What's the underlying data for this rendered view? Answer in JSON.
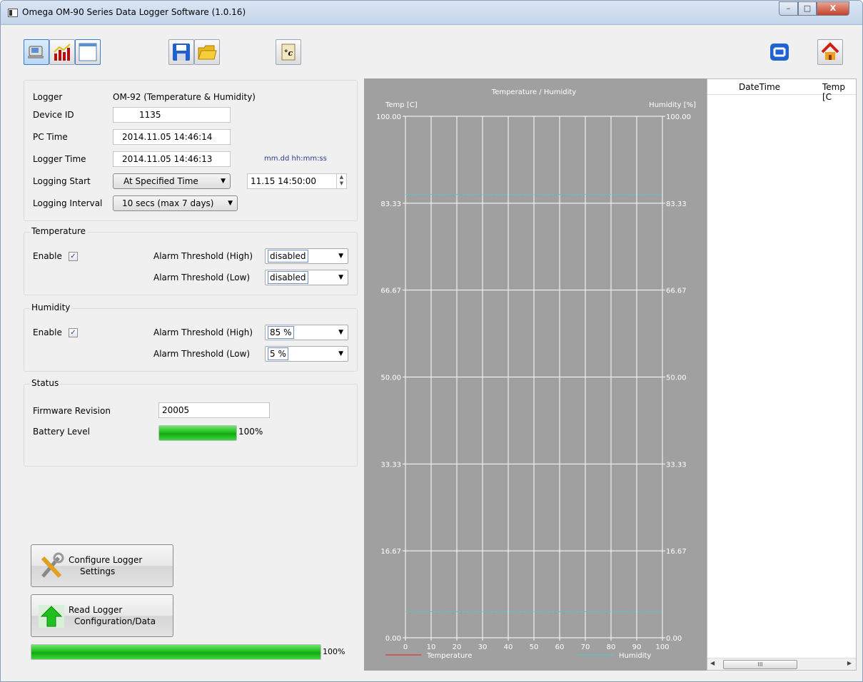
{
  "window": {
    "title": "Omega OM-90 Series Data Logger Software (1.0.16)",
    "min": "–",
    "max": "□",
    "close": "X"
  },
  "logger": {
    "logger_label": "Logger",
    "logger_value": "OM-92 (Temperature & Humidity)",
    "device_id_label": "Device ID",
    "device_id": "1135",
    "pc_time_label": "PC Time",
    "pc_time": "2014.11.05 14:46:14",
    "logger_time_label": "Logger Time",
    "logger_time": "2014.11.05 14:46:13",
    "time_format_hint": "mm.dd hh:mm:ss",
    "logging_start_label": "Logging Start",
    "logging_start": "At Specified Time",
    "logging_start_time": "11.15 14:50:00",
    "logging_interval_label": "Logging Interval",
    "logging_interval": "10 secs (max 7 days)"
  },
  "temperature": {
    "title": "Temperature",
    "enable_label": "Enable",
    "enabled": true,
    "alarm_high_label": "Alarm Threshold (High)",
    "alarm_high": "disabled",
    "alarm_low_label": "Alarm Threshold (Low)",
    "alarm_low": "disabled"
  },
  "humidity": {
    "title": "Humidity",
    "enable_label": "Enable",
    "enabled": true,
    "alarm_high_label": "Alarm Threshold (High)",
    "alarm_high": "85 %",
    "alarm_low_label": "Alarm Threshold (Low)",
    "alarm_low": "5 %"
  },
  "status": {
    "title": "Status",
    "firmware_label": "Firmware Revision",
    "firmware": "20005",
    "battery_label": "Battery Level",
    "battery_percent": 100,
    "battery_text": "100%"
  },
  "actions": {
    "configure_line1": "Configure Logger",
    "configure_line2": "Settings",
    "read_line1": "Read Logger",
    "read_line2": "Configuration/Data",
    "progress_percent": 100,
    "progress_text": "100%"
  },
  "toolbar": {
    "icons": [
      "device-icon",
      "chart-icon",
      "table-icon",
      "save-icon",
      "open-folder-icon",
      "celsius-icon",
      "refresh-icon",
      "home-icon"
    ]
  },
  "table": {
    "columns": [
      "DateTime",
      "Temp [C"
    ],
    "scroll_thumb": "III"
  },
  "chart_data": {
    "type": "line",
    "title": "Temperature / Humidity",
    "ylabel": "Temp [C]",
    "ylabel_right": "Humidity [%]",
    "x_ticks": [
      "0",
      "10",
      "20",
      "30",
      "40",
      "50",
      "60",
      "70",
      "80",
      "90",
      "100"
    ],
    "xlim": [
      0,
      100
    ],
    "y_ticks": [
      "0.00",
      "16.67",
      "33.33",
      "50.00",
      "66.67",
      "83.33",
      "100.00"
    ],
    "ylim": [
      0,
      100
    ],
    "grid": true,
    "legend_position": "bottom",
    "series": [
      {
        "name": "Temperature",
        "color": "#e02020",
        "values": []
      },
      {
        "name": "Humidity",
        "color": "#40d0d8",
        "values": []
      }
    ],
    "threshold_lines": [
      {
        "series": "Humidity",
        "value": 85
      },
      {
        "series": "Humidity",
        "value": 5
      }
    ],
    "colors": {
      "background": "#a0a0a0",
      "grid": "#ffffff",
      "text": "#ffffff"
    }
  }
}
